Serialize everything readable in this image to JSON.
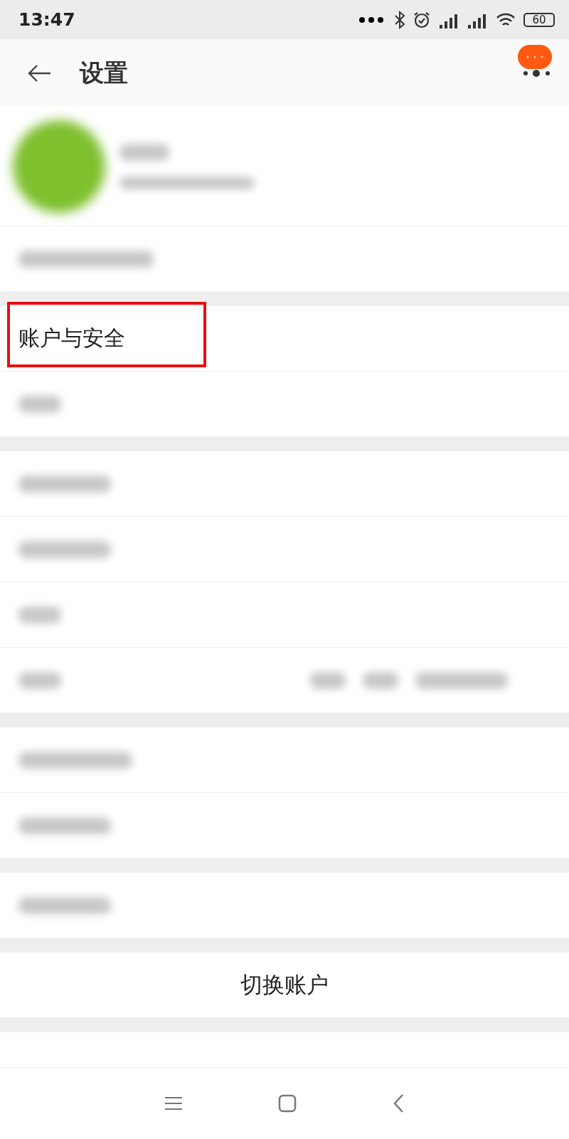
{
  "status_bar": {
    "time": "13:47",
    "battery": "60"
  },
  "header": {
    "title": "设置"
  },
  "sections": [
    {
      "rows": [
        {
          "kind": "profile"
        },
        {
          "kind": "blurred"
        }
      ]
    },
    {
      "rows": [
        {
          "kind": "text",
          "label": "账户与安全",
          "highlighted": true
        },
        {
          "kind": "blurred"
        }
      ]
    },
    {
      "rows": [
        {
          "kind": "blurred"
        },
        {
          "kind": "blurred"
        },
        {
          "kind": "blurred"
        },
        {
          "kind": "blurred_value"
        }
      ]
    },
    {
      "rows": [
        {
          "kind": "blurred"
        },
        {
          "kind": "blurred"
        }
      ]
    },
    {
      "rows": [
        {
          "kind": "blurred"
        }
      ]
    },
    {
      "rows": [
        {
          "kind": "action",
          "label": "切换账户"
        }
      ]
    },
    {
      "rows": [
        {
          "kind": "cut"
        }
      ]
    }
  ]
}
